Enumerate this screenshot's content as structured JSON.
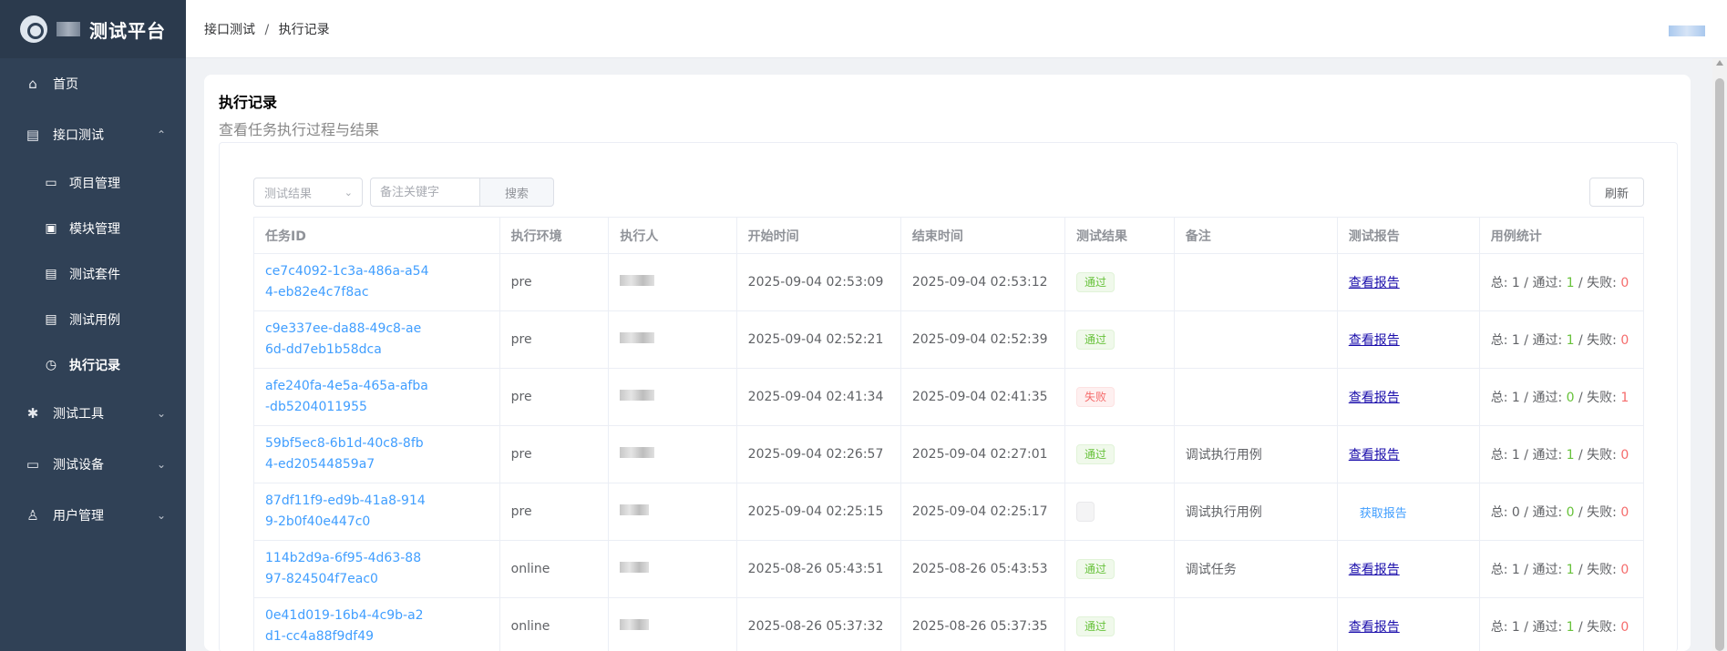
{
  "app": {
    "title": "测试平台"
  },
  "sidebar": {
    "items": [
      {
        "icon": "home-icon",
        "glyph": "⌂",
        "label": "首页",
        "chevron": ""
      },
      {
        "icon": "document-icon",
        "glyph": "▤",
        "label": "接口测试",
        "chevron": "⌃"
      },
      {
        "icon": "folder-icon",
        "glyph": "▭",
        "label": "项目管理",
        "sub": true
      },
      {
        "icon": "module-icon",
        "glyph": "▣",
        "label": "模块管理",
        "sub": true
      },
      {
        "icon": "suite-icon",
        "glyph": "▤",
        "label": "测试套件",
        "sub": true
      },
      {
        "icon": "case-icon",
        "glyph": "▤",
        "label": "测试用例",
        "sub": true
      },
      {
        "icon": "clock-icon",
        "glyph": "◷",
        "label": "执行记录",
        "sub": true,
        "active": true
      },
      {
        "icon": "gear-icon",
        "glyph": "✱",
        "label": "测试工具",
        "chevron": "⌄"
      },
      {
        "icon": "monitor-icon",
        "glyph": "▭",
        "label": "测试设备",
        "chevron": "⌄"
      },
      {
        "icon": "user-icon",
        "glyph": "♙",
        "label": "用户管理",
        "chevron": "⌄"
      }
    ]
  },
  "breadcrumb": {
    "parent": "接口测试",
    "separator": "/",
    "current": "执行记录"
  },
  "page": {
    "title": "执行记录",
    "subtitle": "查看任务执行过程与结果"
  },
  "filters": {
    "result_placeholder": "测试结果",
    "keyword_placeholder": "备注关键字",
    "search_label": "搜索",
    "refresh_label": "刷新"
  },
  "table": {
    "headers": [
      "任务ID",
      "执行环境",
      "执行人",
      "开始时间",
      "结束时间",
      "测试结果",
      "备注",
      "测试报告",
      "用例统计"
    ],
    "rows": [
      {
        "id": "ce7c4092-1c3a-486a-a544-eb82e4c7f8ac",
        "env": "pre",
        "start": "2025-09-04 02:53:09",
        "end": "2025-09-04 02:53:12",
        "result": "通过",
        "status": "pass",
        "note": "",
        "report": "查看报告",
        "total": "1",
        "passed": "1",
        "failed": "0"
      },
      {
        "id": "c9e337ee-da88-49c8-ae6d-dd7eb1b58dca",
        "env": "pre",
        "start": "2025-09-04 02:52:21",
        "end": "2025-09-04 02:52:39",
        "result": "通过",
        "status": "pass",
        "note": "",
        "report": "查看报告",
        "total": "1",
        "passed": "1",
        "failed": "0"
      },
      {
        "id": "afe240fa-4e5a-465a-afba-db5204011955",
        "env": "pre",
        "start": "2025-09-04 02:41:34",
        "end": "2025-09-04 02:41:35",
        "result": "失败",
        "status": "fail",
        "note": "",
        "report": "查看报告",
        "total": "1",
        "passed": "0",
        "failed": "1"
      },
      {
        "id": "59bf5ec8-6b1d-40c8-8fb4-ed20544859a7",
        "env": "pre",
        "start": "2025-09-04 02:26:57",
        "end": "2025-09-04 02:27:01",
        "result": "通过",
        "status": "pass",
        "note": "调试执行用例",
        "report": "查看报告",
        "total": "1",
        "passed": "1",
        "failed": "0"
      },
      {
        "id": "87df11f9-ed9b-41a8-9149-2b0f40e447c0",
        "env": "pre",
        "start": "2025-09-04 02:25:15",
        "end": "2025-09-04 02:25:17",
        "result": "",
        "status": "empty",
        "note": "调试执行用例",
        "report": "获取报告",
        "report_type": "fetch",
        "total": "0",
        "passed": "0",
        "failed": "0"
      },
      {
        "id": "114b2d9a-6f95-4d63-8897-824504f7eac0",
        "env": "online",
        "start": "2025-08-26 05:43:51",
        "end": "2025-08-26 05:43:53",
        "result": "通过",
        "status": "pass",
        "note": "调试任务",
        "report": "查看报告",
        "total": "1",
        "passed": "1",
        "failed": "0"
      },
      {
        "id": "0e41d019-16b4-4c9b-a2d1-cc4a88f9df49",
        "env": "online",
        "start": "2025-08-26 05:37:32",
        "end": "2025-08-26 05:37:35",
        "result": "通过",
        "status": "pass",
        "note": "",
        "report": "查看报告",
        "total": "1",
        "passed": "1",
        "failed": "0"
      }
    ],
    "stats_labels": {
      "total": "总: ",
      "passed": " / 通过: ",
      "failed": " / 失败: "
    }
  },
  "colors": {
    "sidebar_bg": "#304156",
    "link": "#409eff",
    "pass": "#67c23a",
    "fail": "#f56c6c"
  }
}
